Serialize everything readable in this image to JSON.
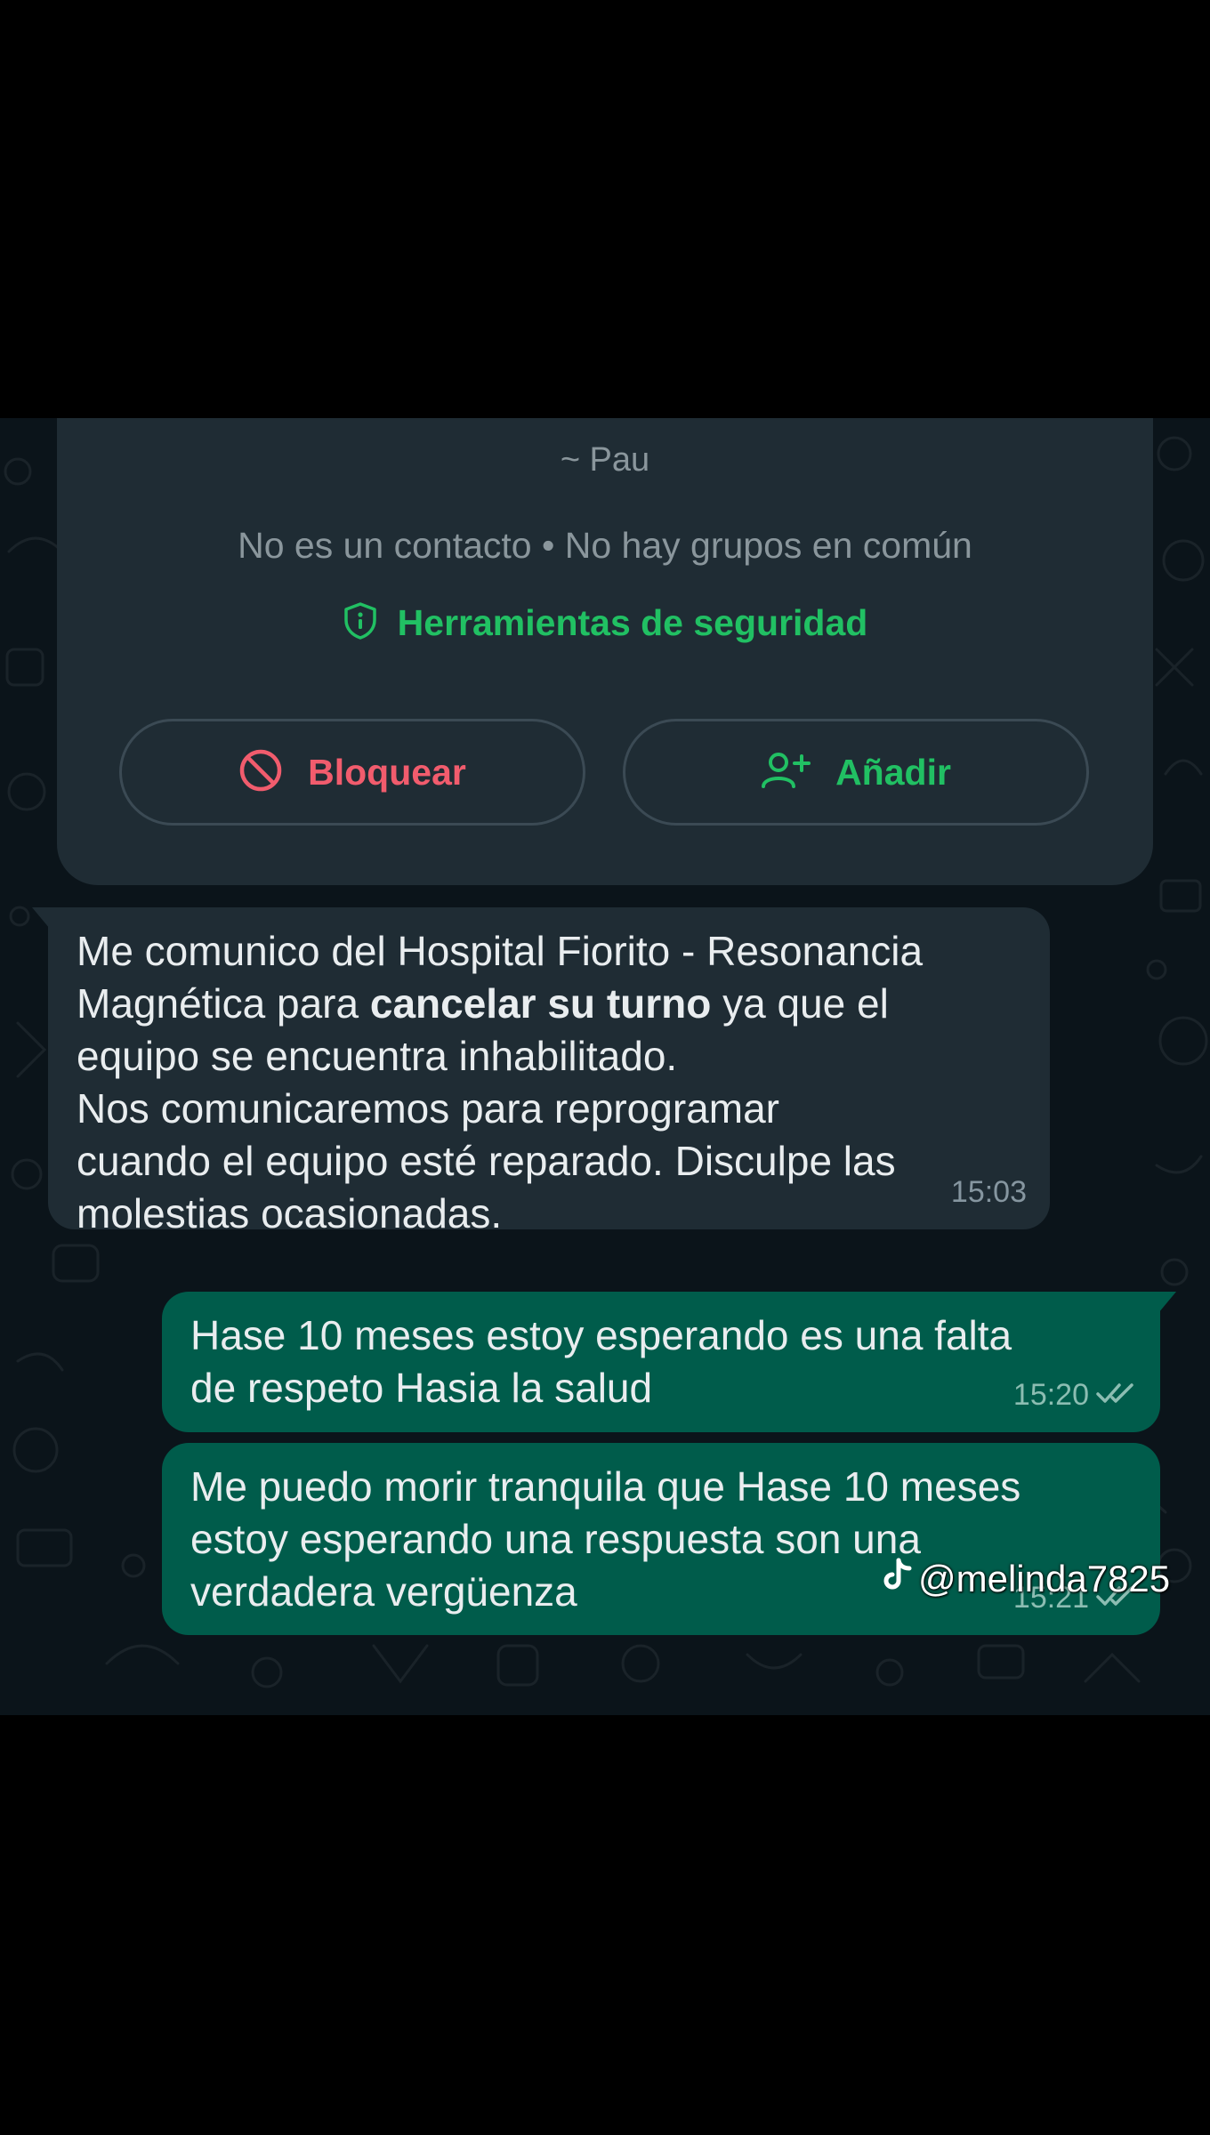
{
  "contact": {
    "name": "~ Pau",
    "meta": "No es un contacto • No hay grupos en común",
    "safety_label": "Herramientas de seguridad",
    "safety_icon": "shield-info-icon"
  },
  "actions": {
    "block_label": "Bloquear",
    "block_icon": "block-icon",
    "add_label": "Añadir",
    "add_icon": "add-person-icon"
  },
  "messages": [
    {
      "direction": "incoming",
      "line1": "Me comunico del Hospital Fiorito - Resonancia",
      "line2_before": "Magnética para ",
      "line2_bold": "cancelar su turno",
      "line2_after": " ya que el",
      "line3": "equipo se encuentra inhabilitado.",
      "line4": "Nos comunicaremos  para reprogramar",
      "line5": "cuando el equipo esté reparado. Disculpe las",
      "line6": "molestias ocasionadas.",
      "time": "15:03"
    },
    {
      "direction": "outgoing",
      "line1": "Hase 10 meses estoy esperando es una falta",
      "line2": "de respeto Hasia la salud",
      "time": "15:20",
      "status_icon": "double-check-icon"
    },
    {
      "direction": "outgoing",
      "line1": "Me puedo morir tranquila que Hase 10 meses",
      "line2": "estoy esperando una respuesta son una",
      "line3": "verdadera vergüenza",
      "time": "15:21",
      "status_icon": "double-check-icon"
    }
  ],
  "watermark": {
    "handle": "@melinda7825",
    "icon": "tiktok-icon"
  },
  "colors": {
    "background": "#0b141a",
    "card": "#1f2c34",
    "incoming_bubble": "#1f2c34",
    "outgoing_bubble": "#005c4b",
    "accent_green": "#21c063",
    "danger_red": "#f15c6d"
  }
}
